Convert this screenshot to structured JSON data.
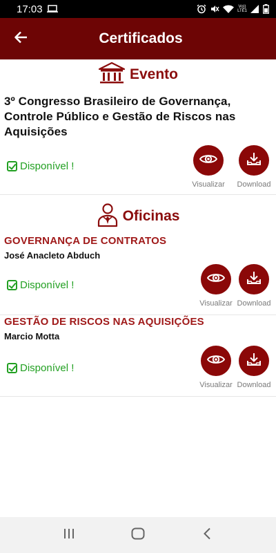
{
  "status_bar": {
    "time": "17:03",
    "network_label_top": "Vo))",
    "network_label_bottom": "LTE1"
  },
  "app_bar": {
    "title": "Certificados",
    "back_icon": "arrow-left-icon"
  },
  "evento": {
    "section_title": "Evento",
    "icon": "bank-building-icon",
    "title": "3º Congresso Brasileiro de Governança, Controle Público e Gestão de Riscos nas Aquisições",
    "status": "Disponível !",
    "visualizar_label": "Visualizar",
    "download_label": "Download"
  },
  "oficinas": {
    "section_title": "Oficinas",
    "icon": "person-tie-icon",
    "items": [
      {
        "title": "GOVERNANÇA DE CONTRATOS",
        "instructor": "José Anacleto Abduch",
        "status": "Disponível !",
        "visualizar_label": "Visualizar",
        "download_label": "Download"
      },
      {
        "title": "GESTÃO DE RISCOS NAS AQUISIÇÕES",
        "instructor": "Marcio Motta",
        "status": "Disponível !",
        "visualizar_label": "Visualizar",
        "download_label": "Download"
      }
    ]
  },
  "colors": {
    "primary": "#6d0505",
    "accent": "#8b0808",
    "course_title": "#a01a1a",
    "available": "#22a022"
  }
}
